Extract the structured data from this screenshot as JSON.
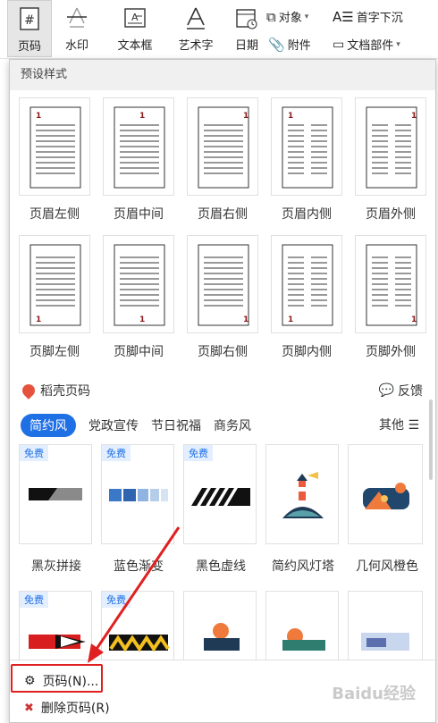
{
  "toolbar": {
    "page_number": "页码",
    "watermark": "水印",
    "textbox": "文本框",
    "wordart": "艺术字",
    "date": "日期",
    "object": "对象",
    "dropcap": "首字下沉",
    "attachment": "附件",
    "docparts": "文档部件"
  },
  "preset": {
    "title": "预设样式",
    "header_items": [
      "页眉左侧",
      "页眉中间",
      "页眉右侧",
      "页眉内侧",
      "页眉外侧"
    ],
    "footer_items": [
      "页脚左侧",
      "页脚中间",
      "页脚右侧",
      "页脚内侧",
      "页脚外侧"
    ],
    "page_num": "1"
  },
  "wk": {
    "title": "稻壳页码",
    "feedback": "反馈"
  },
  "tabs": [
    "简约风",
    "党政宣传",
    "节日祝福",
    "商务风"
  ],
  "other_label": "其他",
  "free_badge": "免费",
  "cards": [
    "黑灰拼接",
    "蓝色渐变",
    "黑色虚线",
    "简约风灯塔",
    "几何风橙色"
  ],
  "menu": {
    "page_number": "页码(N)...",
    "delete_page_number": "删除页码(R)"
  },
  "watermark_text": "Baidu经验",
  "colors": {
    "accent": "#1f6fe5",
    "highlight": "#e02020"
  }
}
